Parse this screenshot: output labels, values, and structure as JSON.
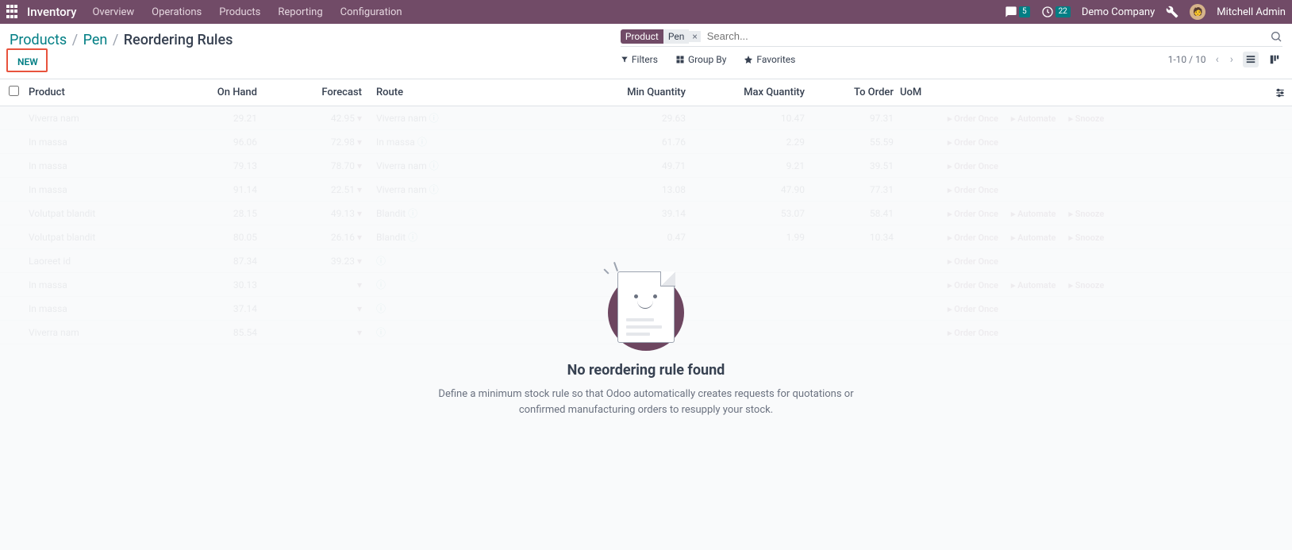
{
  "nav": {
    "brand": "Inventory",
    "items": [
      "Overview",
      "Operations",
      "Products",
      "Reporting",
      "Configuration"
    ],
    "chat_badge": "5",
    "activity_badge": "22",
    "company": "Demo Company",
    "user_name": "Mitchell Admin"
  },
  "breadcrumb": {
    "parts": [
      "Products",
      "Pen",
      "Reordering Rules"
    ]
  },
  "buttons": {
    "new": "NEW"
  },
  "search": {
    "chip_key": "Product",
    "chip_val": "Pen",
    "placeholder": "Search..."
  },
  "tools": {
    "filters": "Filters",
    "groupby": "Group By",
    "favorites": "Favorites"
  },
  "pager": {
    "text": "1-10 / 10"
  },
  "columns": {
    "product": "Product",
    "onhand": "On Hand",
    "forecast": "Forecast",
    "route": "Route",
    "min": "Min Quantity",
    "max": "Max Quantity",
    "toorder": "To Order",
    "uom": "UoM"
  },
  "ghost_rows": [
    {
      "product": "Viverra nam",
      "onhand": "29.21",
      "forecast": "42.95",
      "route": "Viverra nam",
      "min": "29.63",
      "max": "10.47",
      "toorder": "97.31",
      "actions": [
        "Order Once",
        "Automate",
        "Snooze"
      ]
    },
    {
      "product": "In massa",
      "onhand": "96.06",
      "forecast": "72.98",
      "route": "In massa",
      "min": "61.76",
      "max": "2.29",
      "toorder": "55.59",
      "actions": [
        "Order Once"
      ]
    },
    {
      "product": "In massa",
      "onhand": "79.13",
      "forecast": "78.70",
      "route": "Viverra nam",
      "min": "49.71",
      "max": "9.21",
      "toorder": "39.51",
      "actions": [
        "Order Once"
      ]
    },
    {
      "product": "In massa",
      "onhand": "91.14",
      "forecast": "22.51",
      "route": "Viverra nam",
      "min": "13.08",
      "max": "47.90",
      "toorder": "77.31",
      "actions": [
        "Order Once"
      ]
    },
    {
      "product": "Volutpat blandit",
      "onhand": "28.15",
      "forecast": "49.13",
      "route": "Blandit",
      "min": "39.14",
      "max": "53.07",
      "toorder": "58.41",
      "actions": [
        "Order Once",
        "Automate",
        "Snooze"
      ]
    },
    {
      "product": "Volutpat blandit",
      "onhand": "80.05",
      "forecast": "26.16",
      "route": "Blandit",
      "min": "0.47",
      "max": "1.99",
      "toorder": "10.34",
      "actions": [
        "Order Once",
        "Automate",
        "Snooze"
      ]
    },
    {
      "product": "Laoreet id",
      "onhand": "87.34",
      "forecast": "39.23",
      "route": "",
      "min": "",
      "max": "",
      "toorder": "",
      "actions": [
        "Order Once"
      ]
    },
    {
      "product": "In massa",
      "onhand": "30.13",
      "forecast": "",
      "route": "",
      "min": "",
      "max": "",
      "toorder": "",
      "actions": [
        "Order Once",
        "Automate",
        "Snooze"
      ]
    },
    {
      "product": "In massa",
      "onhand": "37.14",
      "forecast": "",
      "route": "",
      "min": "",
      "max": "",
      "toorder": "",
      "actions": [
        "Order Once"
      ]
    },
    {
      "product": "Viverra nam",
      "onhand": "85.54",
      "forecast": "",
      "route": "",
      "min": "",
      "max": "",
      "toorder": "",
      "actions": [
        "Order Once"
      ]
    }
  ],
  "empty": {
    "title": "No reordering rule found",
    "subtitle": "Define a minimum stock rule so that Odoo automatically creates requests for quotations or confirmed manufacturing orders to resupply your stock."
  }
}
